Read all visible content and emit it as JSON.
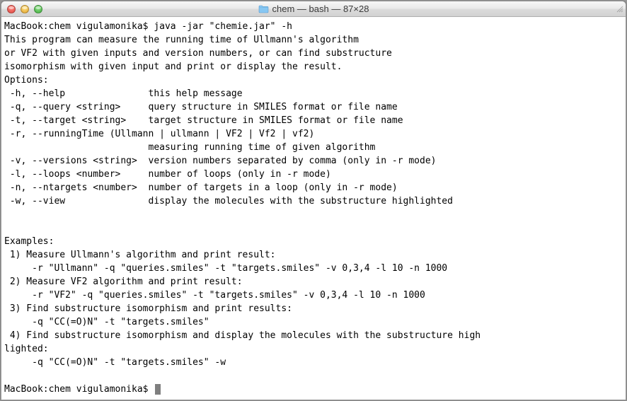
{
  "window": {
    "title": "chem — bash — 87×28",
    "folder_name": "chem"
  },
  "prompt": {
    "host": "MacBook",
    "dir": "chem",
    "user": "vigulamonika",
    "symbol": "$"
  },
  "command": "java -jar \"chemie.jar\" -h",
  "output": {
    "intro": [
      "This program can measure the running time of Ullmann's algorithm",
      "or VF2 with given inputs and version numbers, or can find substructure",
      "isomorphism with given input and print or display the result."
    ],
    "options_header": "Options:",
    "options": [
      {
        "flag": " -h, --help               ",
        "desc": "this help message"
      },
      {
        "flag": " -q, --query <string>     ",
        "desc": "query structure in SMILES format or file name"
      },
      {
        "flag": " -t, --target <string>    ",
        "desc": "target structure in SMILES format or file name"
      },
      {
        "flag": " -r, --runningTime (Ullmann | ullmann | VF2 | Vf2 | vf2)",
        "desc": ""
      },
      {
        "flag": "                          ",
        "desc": "measuring running time of given algorithm"
      },
      {
        "flag": " -v, --versions <string>  ",
        "desc": "version numbers separated by comma (only in -r mode)"
      },
      {
        "flag": " -l, --loops <number>     ",
        "desc": "number of loops (only in -r mode)"
      },
      {
        "flag": " -n, --ntargets <number>  ",
        "desc": "number of targets in a loop (only in -r mode)"
      },
      {
        "flag": " -w, --view               ",
        "desc": "display the molecules with the substructure highlighted"
      }
    ],
    "examples_header": "Examples:",
    "examples": [
      " 1) Measure Ullmann's algorithm and print result:",
      "     -r \"Ullmann\" -q \"queries.smiles\" -t \"targets.smiles\" -v 0,3,4 -l 10 -n 1000",
      " 2) Measure VF2 algorithm and print result:",
      "     -r \"VF2\" -q \"queries.smiles\" -t \"targets.smiles\" -v 0,3,4 -l 10 -n 1000",
      " 3) Find substructure isomorphism and print results:",
      "     -q \"CC(=O)N\" -t \"targets.smiles\"",
      " 4) Find substructure isomorphism and display the molecules with the substructure high",
      "lighted:",
      "     -q \"CC(=O)N\" -t \"targets.smiles\" -w"
    ]
  }
}
